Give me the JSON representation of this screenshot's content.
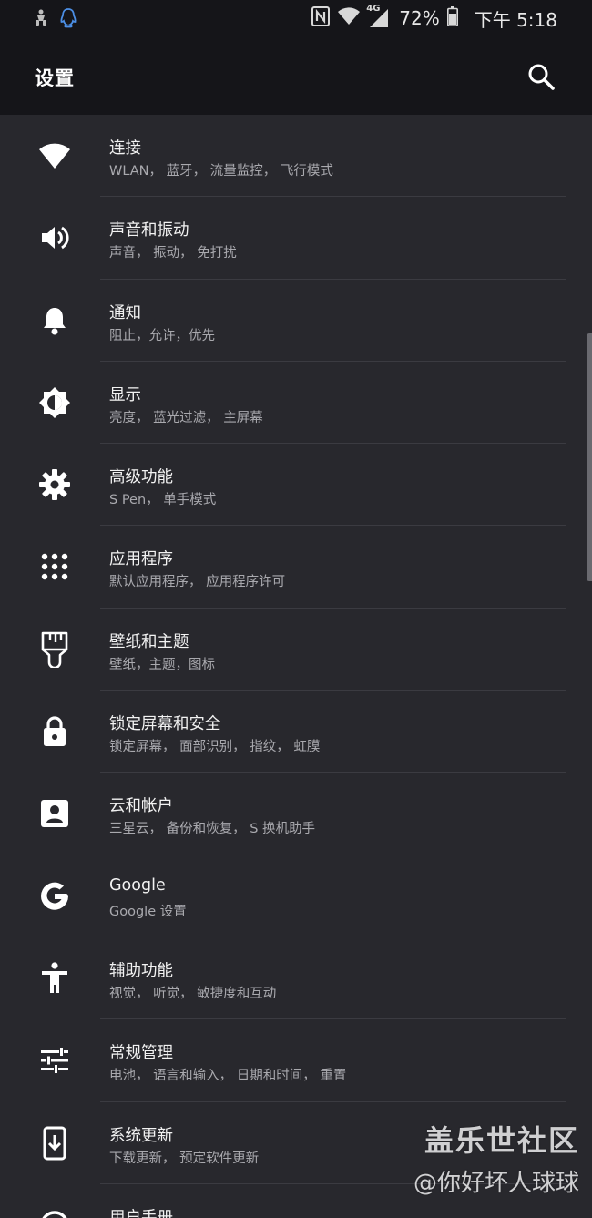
{
  "status_bar": {
    "left_icons": [
      "usb-debug-icon",
      "qq-notification-icon"
    ],
    "right_icons": [
      "nfc-icon",
      "wifi-icon",
      "signal-4g-icon",
      "battery-icon"
    ],
    "network_type": "4G",
    "battery_percent": "72%",
    "time": "下午 5:18"
  },
  "app_bar": {
    "title": "设置",
    "search_icon": "search-icon"
  },
  "settings": [
    {
      "icon": "wifi-icon",
      "title": "连接",
      "summary": "WLAN， 蓝牙， 流量监控， 飞行模式"
    },
    {
      "icon": "volume-icon",
      "title": "声音和振动",
      "summary": "声音， 振动， 免打扰"
    },
    {
      "icon": "bell-icon",
      "title": "通知",
      "summary": "阻止，允许，优先"
    },
    {
      "icon": "brightness-icon",
      "title": "显示",
      "summary": "亮度， 蓝光过滤， 主屏幕"
    },
    {
      "icon": "gear-icon",
      "title": "高级功能",
      "summary": "S Pen， 单手模式"
    },
    {
      "icon": "apps-grid-icon",
      "title": "应用程序",
      "summary": "默认应用程序， 应用程序许可"
    },
    {
      "icon": "paint-brush-icon",
      "title": "壁纸和主题",
      "summary": "壁纸，主题，图标"
    },
    {
      "icon": "lock-icon",
      "title": "锁定屏幕和安全",
      "summary": "锁定屏幕， 面部识别， 指纹， 虹膜"
    },
    {
      "icon": "account-icon",
      "title": "云和帐户",
      "summary": "三星云， 备份和恢复， S 换机助手"
    },
    {
      "icon": "google-icon",
      "title": "Google",
      "summary": "Google 设置"
    },
    {
      "icon": "accessibility-icon",
      "title": "辅助功能",
      "summary": "视觉， 听觉， 敏捷度和互动"
    },
    {
      "icon": "sliders-icon",
      "title": "常规管理",
      "summary": "电池， 语言和输入， 日期和时间， 重置"
    },
    {
      "icon": "system-update-icon",
      "title": "系统更新",
      "summary": "下载更新， 预定软件更新"
    },
    {
      "icon": "help-icon",
      "title": "用户手册",
      "summary": ""
    }
  ],
  "scroll_position_fraction": 0.2,
  "watermark": {
    "main": "盖乐世社区",
    "sub": "@你好坏人球球"
  },
  "colors": {
    "background": "#28282d",
    "header": "#151519",
    "title_text": "#f2f2f2",
    "summary_text": "#a9a9ae",
    "divider": "#3b3b41"
  }
}
